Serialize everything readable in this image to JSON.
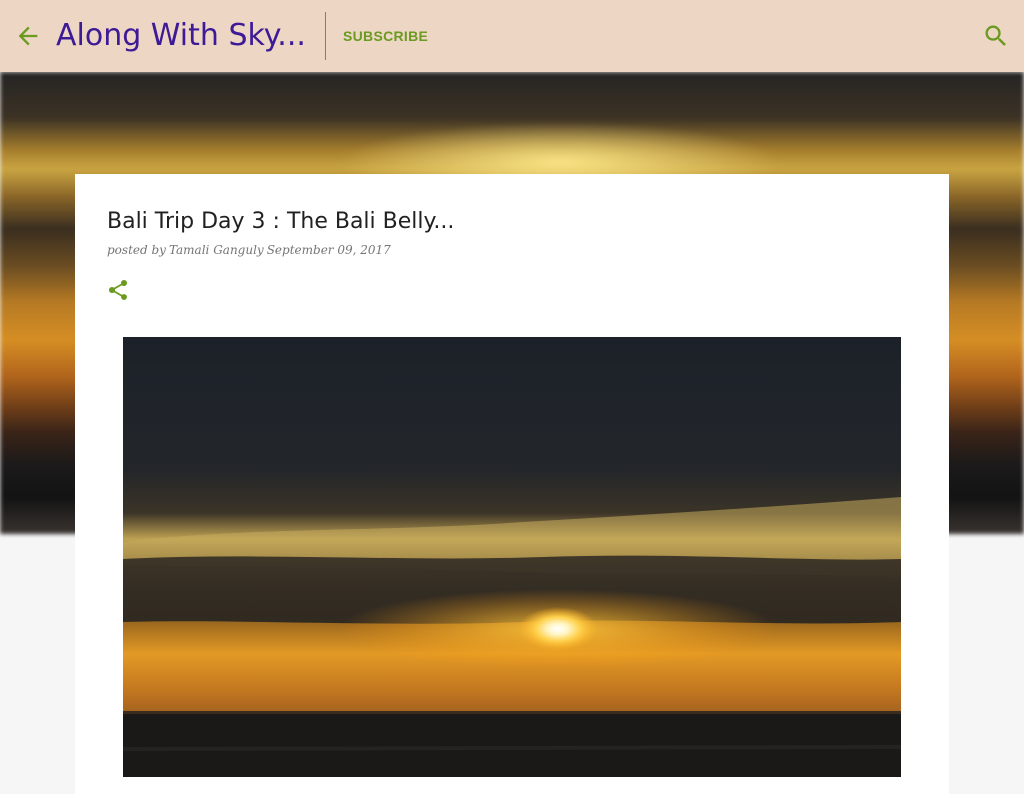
{
  "header": {
    "site_title": "Along With Sky...",
    "subscribe_label": "SUBSCRIBE",
    "back_icon": "arrow-back-icon",
    "search_icon": "search-icon"
  },
  "post": {
    "title": "Bali Trip Day 3 : The Bali Belly...",
    "byline_prefix": "posted by",
    "author": "Tamali Ganguly",
    "date": "September 09, 2017",
    "share_icon": "share-icon"
  },
  "colors": {
    "header_bg": "#eed6c4",
    "title_color": "#3d1a96",
    "accent_green": "#6a9a1f",
    "page_bg": "#f6f6f6"
  }
}
